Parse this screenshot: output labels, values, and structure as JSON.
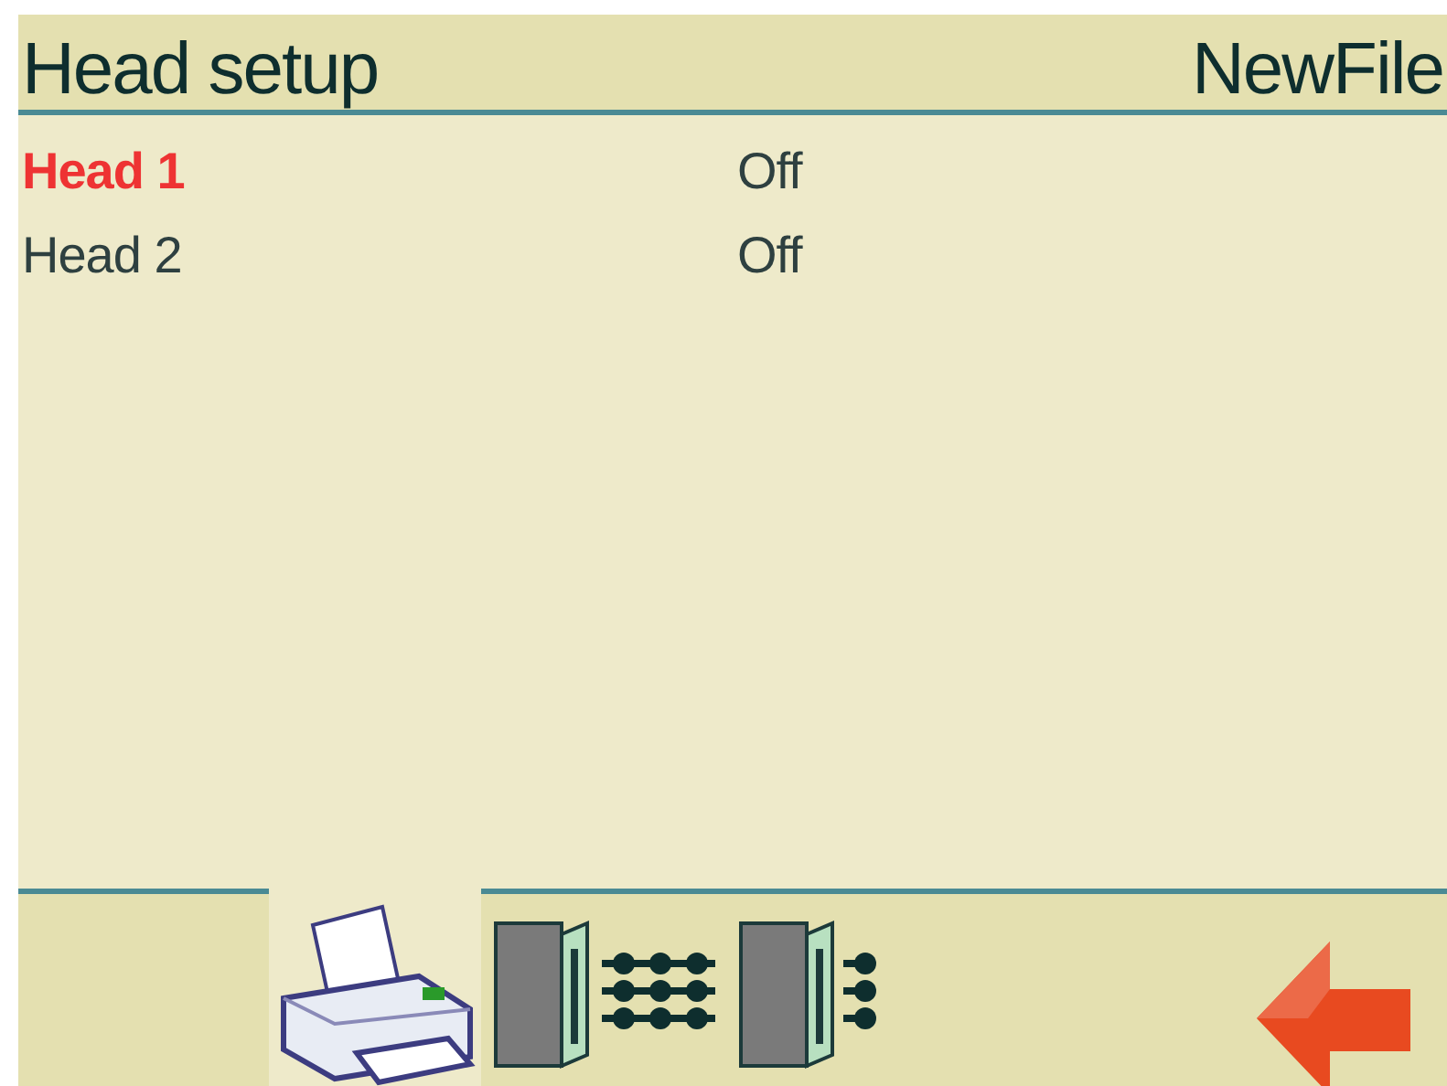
{
  "header": {
    "title": "Head setup",
    "file": "NewFile"
  },
  "heads": [
    {
      "name": "Head 1",
      "value": "Off",
      "selected": true
    },
    {
      "name": "Head 2",
      "value": "Off",
      "selected": false
    }
  ],
  "toolbar": {
    "tabs": [
      {
        "kind": "printer",
        "selected": true
      },
      {
        "kind": "multi-head",
        "selected": false
      },
      {
        "kind": "single-head",
        "selected": false
      }
    ]
  }
}
